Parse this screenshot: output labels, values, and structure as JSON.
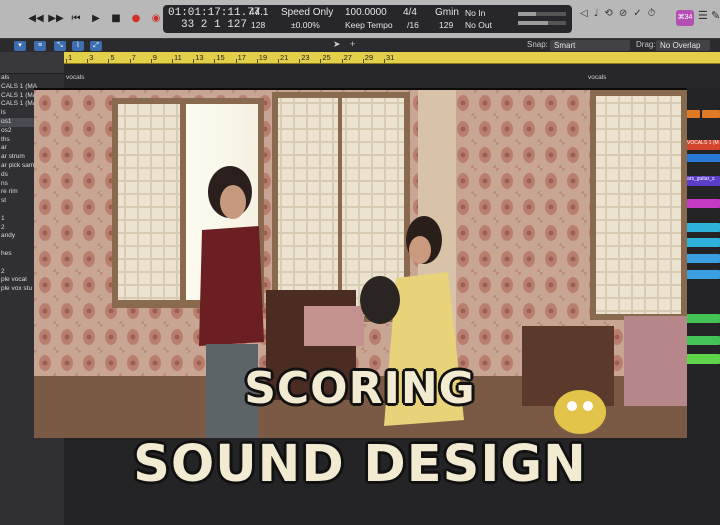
{
  "lcd": {
    "position_time": "01:01:17:11.77",
    "position_bars": "33  2  1  127",
    "sample_rate": "44.1",
    "buffer": "128",
    "mode": "Speed Only",
    "mode_pct": "±0.00%",
    "tempo": "100.0000",
    "keep_tempo": "Keep Tempo",
    "time_sig": "4/4",
    "division": "/16",
    "key": "Gmin",
    "key_tempo": "129",
    "midi_in": "No In",
    "midi_out": "No Out"
  },
  "toolbar": {
    "snap_label": "Snap:",
    "snap_value": "Smart",
    "drag_label": "Drag:",
    "drag_value": "No Overlap",
    "badge": "⌘34"
  },
  "ruler": {
    "bars": [
      "1",
      "3",
      "5",
      "7",
      "9",
      "11",
      "13",
      "15",
      "17",
      "19",
      "21",
      "23",
      "25",
      "27",
      "29",
      "31"
    ]
  },
  "region_labels": [
    "vocals",
    "vocals"
  ],
  "tracks": [
    "als",
    "CALS 1 (MA",
    "CALS 1 (MA",
    "CALS 1 (MA",
    "ls",
    "os1",
    "os2",
    "ths",
    "ar",
    "ar strum",
    "ar pick sam",
    "ds",
    "ns",
    "re rim",
    "st",
    "",
    "1",
    "2",
    "andy",
    "",
    "hes",
    "",
    "2",
    "ple vocal",
    "ple vox stu"
  ],
  "arrange_labels": [
    "VOCALS 1 (M",
    "ars_guitar_s"
  ],
  "overlay": {
    "line1": "SCORING",
    "line2": "SOUND DESIGN"
  }
}
